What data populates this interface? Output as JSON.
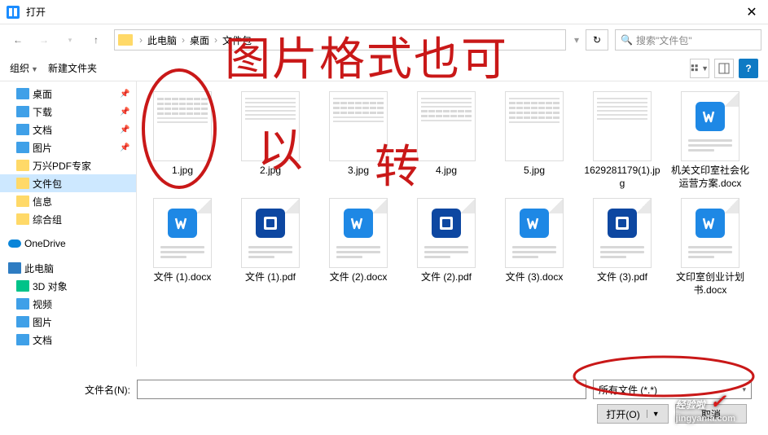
{
  "title": "打开",
  "path": {
    "root": "此电脑",
    "seg1": "桌面",
    "seg2": "文件包"
  },
  "search_placeholder": "搜索\"文件包\"",
  "toolbar": {
    "organize": "组织",
    "newfolder": "新建文件夹"
  },
  "sidebar": {
    "desktop": "桌面",
    "downloads": "下载",
    "documents": "文档",
    "pictures": "图片",
    "wx": "万兴PDF专家",
    "pkg": "文件包",
    "info": "信息",
    "group": "综合组",
    "onedrive": "OneDrive",
    "thispc": "此电脑",
    "obj3d": "3D 对象",
    "video": "视频",
    "pics2": "图片",
    "docs2": "文档"
  },
  "files": [
    {
      "name": "1.jpg",
      "type": "img"
    },
    {
      "name": "2.jpg",
      "type": "img"
    },
    {
      "name": "3.jpg",
      "type": "img"
    },
    {
      "name": "4.jpg",
      "type": "img"
    },
    {
      "name": "5.jpg",
      "type": "img"
    },
    {
      "name": "1629281179(1).jpg",
      "type": "img"
    },
    {
      "name": "机关文印室社会化运营方案.docx",
      "type": "word"
    },
    {
      "name": "文件 (1).docx",
      "type": "word"
    },
    {
      "name": "文件 (1).pdf",
      "type": "pdf"
    },
    {
      "name": "文件 (2).docx",
      "type": "word"
    },
    {
      "name": "文件 (2).pdf",
      "type": "pdf"
    },
    {
      "name": "文件 (3).docx",
      "type": "word"
    },
    {
      "name": "文件 (3).pdf",
      "type": "pdf"
    },
    {
      "name": "文印室创业计划书.docx",
      "type": "word"
    }
  ],
  "bottom": {
    "filename_label": "文件名(N):",
    "filename_value": "",
    "filter": "所有文件 (*.*)",
    "open": "打开(O)",
    "cancel": "取消"
  },
  "annotation": {
    "line1": "图片格式也可",
    "line2": "以",
    "line3": "转"
  },
  "watermark": {
    "brand": "经验啦",
    "url": "jingyanla.com"
  }
}
